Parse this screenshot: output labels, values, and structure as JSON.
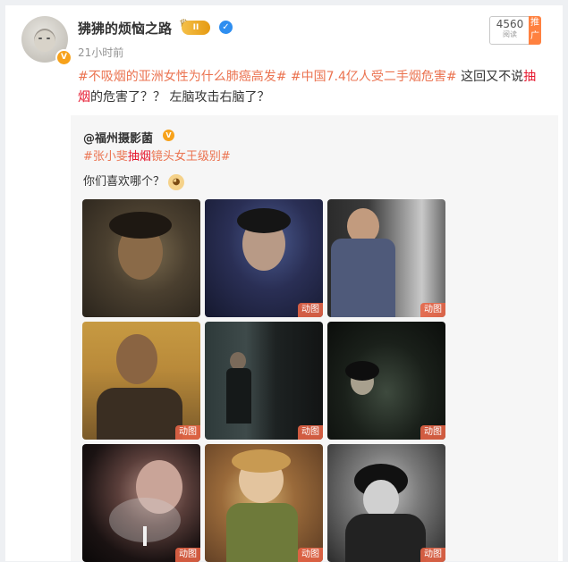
{
  "post": {
    "username": "狒狒的烦恼之路",
    "level_badge": "II",
    "time": "21小时前",
    "views_count": "4560",
    "views_label": "阅读",
    "promo_label": "推广",
    "text_tag1": "#不吸烟的亚洲女性为什么肺癌高发#",
    "text_tag2": "#中国7.4亿人受二手烟危害#",
    "text_part1": " 这回又不说",
    "text_red1": "抽烟",
    "text_part2": "的危害了？？ 左脑攻击右脑了？"
  },
  "repost": {
    "username": "@福州摄影菌",
    "tag_part1": "#张小斐",
    "tag_red": "抽烟",
    "tag_part2": "镜头女王级别#",
    "question": "你们喜欢哪个？"
  },
  "images": [
    {
      "gif": ""
    },
    {
      "gif": "动图"
    },
    {
      "gif": "动图"
    },
    {
      "gif": "动图"
    },
    {
      "gif": "动图"
    },
    {
      "gif": "动图"
    },
    {
      "gif": "动图"
    },
    {
      "gif": "动图"
    },
    {
      "gif": "动图"
    }
  ],
  "colors": {
    "tag": "#eb7350",
    "highlight": "#e6162d",
    "promo": "#ff8140",
    "verified": "#2e8ef0"
  }
}
